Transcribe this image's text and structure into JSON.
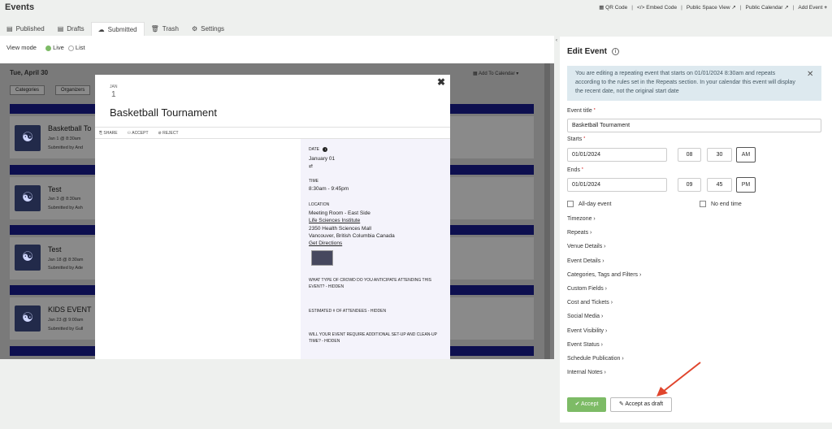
{
  "app": {
    "title": "Events"
  },
  "top_links": [
    {
      "label": "QR Code"
    },
    {
      "label": "Embed Code"
    },
    {
      "label": "Public Space View"
    },
    {
      "label": "Public Calendar"
    },
    {
      "label": "Add Event"
    }
  ],
  "tabs": [
    {
      "label": "Published"
    },
    {
      "label": "Drafts"
    },
    {
      "label": "Submitted"
    },
    {
      "label": "Trash"
    },
    {
      "label": "Settings"
    }
  ],
  "view_mode": {
    "label": "View mode",
    "options": [
      "Live",
      "List"
    ],
    "selected": "Live"
  },
  "listing": {
    "date": "Tue, April 30",
    "add_to_calendar": "Add To Calendar",
    "filters": [
      "Categories",
      "Organizers"
    ],
    "events": [
      {
        "title": "Basketball To",
        "date": "Jan 1 @ 8:30am",
        "submitted": "Submitted by And"
      },
      {
        "title": "Test",
        "date": "Jan 3 @ 8:30am",
        "submitted": "Submitted by Ash"
      },
      {
        "title": "Test",
        "date": "Jan 18 @ 8:30am",
        "submitted": "Submitted by Ade"
      },
      {
        "title": "KIDS EVENT",
        "date": "Jan 23 @ 9:00am",
        "submitted": "Submitted by Gull"
      }
    ]
  },
  "modal": {
    "month": "JAN",
    "day": "1",
    "title": "Basketball Tournament",
    "actions": [
      "SHARE",
      "ACCEPT",
      "REJECT"
    ],
    "date_label": "DATE",
    "date_value": "January 01",
    "time_label": "TIME",
    "time_value": "8:30am  - 9:45pm",
    "location_label": "LOCATION",
    "location_lines": [
      "Meeting Room - East Side",
      "Life Sciences Institute",
      "2350 Health Sciences Mall",
      "Vancouver,  British Columbia  Canada",
      "Get Directions"
    ],
    "q1": [
      "WHAT TYPE OF CROWD DO YOU ANTICIPATE ATTENDING THIS",
      "EVENT? - HIDDEN"
    ],
    "q2": "ESTIMATED # OF ATTENDEES - HIDDEN",
    "q3": [
      "WILL YOUR EVENT REQUIRE ADDITIONAL SET-UP AND CLEAN-UP",
      "TIME? - HIDDEN"
    ]
  },
  "edit": {
    "heading": "Edit Event",
    "notice": "You are editing a repeating event that starts on 01/01/2024 8:30am and repeats according to the rules set in the Repeats section. In your calendar this event will display the recent date, not the original start date",
    "title_label": "Event title",
    "title_value": "Basketball Tournament",
    "starts_label": "Starts",
    "start_date": "01/01/2024",
    "start_hour": "08",
    "start_min": "30",
    "start_ampm": "AM",
    "ends_label": "Ends",
    "end_date": "01/01/2024",
    "end_hour": "09",
    "end_min": "45",
    "end_ampm": "PM",
    "allday_label": "All-day event",
    "noend_label": "No end time",
    "sections": [
      "Timezone",
      "Repeats",
      "Venue Details",
      "Event Details",
      "Categories, Tags and Filters",
      "Custom Fields",
      "Cost and Tickets",
      "Social Media",
      "Event Visibility",
      "Event Status",
      "Schedule Publication",
      "Internal Notes"
    ],
    "accept_label": "Accept",
    "draft_label": "Accept as draft"
  },
  "colors": {
    "accent_green": "#7dbb66",
    "navy_bar": "#0d0f4f",
    "arrow_red": "#e0452d"
  }
}
